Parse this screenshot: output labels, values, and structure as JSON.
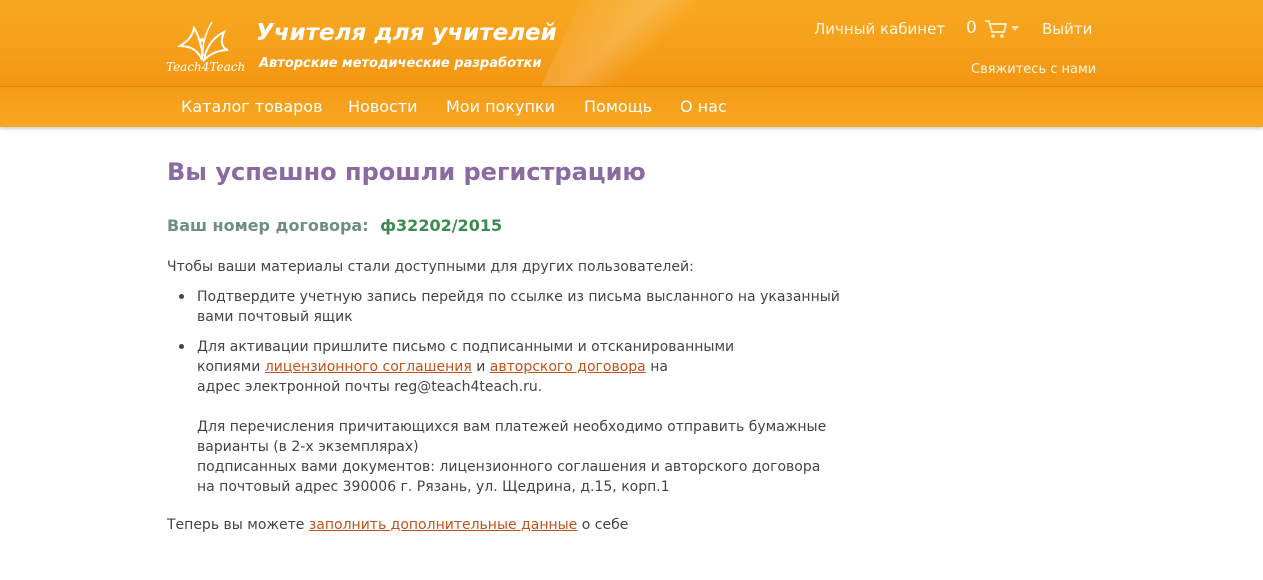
{
  "header": {
    "logo_text": "Teach4Teach",
    "site_title": "Учителя для учителей",
    "site_subtitle": "Авторские методические разработки",
    "account_link": "Личный кабинет",
    "cart_count": "0",
    "logout_link": "Выйти",
    "contact_link": "Свяжитесь с нами",
    "icons": {
      "logo": "butterfly-logo-icon",
      "cart": "cart-icon",
      "caret": "caret-down-icon"
    }
  },
  "nav": {
    "items": [
      {
        "label": "Каталог товаров"
      },
      {
        "label": "Новости"
      },
      {
        "label": "Мои покупки"
      },
      {
        "label": "Помощь"
      },
      {
        "label": "О нас"
      }
    ]
  },
  "main": {
    "title": "Вы успешно прошли регистрацию",
    "contract_label": "Ваш номер договора:",
    "contract_number": "ф32202/2015",
    "intro": "Чтобы ваши материалы стали доступными для других пользователей:",
    "bullet1": {
      "line1": "Подтвердите учетную запись перейдя по ссылке из письма высланного на указанный",
      "line2": "вами почтовый ящик"
    },
    "bullet2": {
      "line1": "Для активации пришлите письмо с подписанными и отсканированными",
      "line2_prefix": "копиями",
      "link_license": "лицензионного соглашения",
      "and": "и",
      "link_author": "авторского договора",
      "line2_suffix": "на",
      "line3": "адрес электронной почты reg@teach4teach.ru.",
      "line4": "Для перечисления причитающихся вам платежей необходимо отправить бумажные",
      "line5": "варианты (в 2-х экземплярах)",
      "line6": "подписанных вами документов: лицензионного соглашения и авторского договора",
      "line7": "на почтовый адрес 390006 г. Рязань, ул. Щедрина, д.15, корп.1"
    },
    "footer": {
      "prefix": "Теперь вы можете",
      "link": "заполнить дополнительные данные",
      "suffix": "о себе"
    }
  },
  "colors": {
    "header_orange": "#f7a821",
    "title_purple": "#8a6aa1",
    "contract_green": "#3d8a4d",
    "link_orange": "#c2521b"
  }
}
